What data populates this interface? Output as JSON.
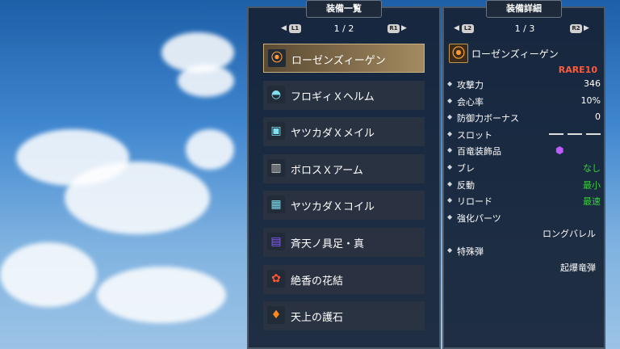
{
  "left_panel": {
    "title": "装備一覧",
    "pager": {
      "left_btn": "L1",
      "page": "1 / 2",
      "right_btn": "R1"
    },
    "items": [
      {
        "label": "ローゼンズィーゲン",
        "icon": "gun-icon",
        "glyph": "⦿",
        "color": "#ff9a33",
        "selected": true
      },
      {
        "label": "フロギィＸヘルム",
        "icon": "helmet-icon",
        "glyph": "◓",
        "color": "#7fe0f0"
      },
      {
        "label": "ヤツカダＸメイル",
        "icon": "chest-armor-icon",
        "glyph": "▣",
        "color": "#7fe0f0"
      },
      {
        "label": "ボロスＸアーム",
        "icon": "arm-armor-icon",
        "glyph": "▥",
        "color": "#d8d8d8"
      },
      {
        "label": "ヤツカダＸコイル",
        "icon": "waist-armor-icon",
        "glyph": "▦",
        "color": "#7fe0f0"
      },
      {
        "label": "斉天ノ具足・真",
        "icon": "leg-armor-icon",
        "glyph": "▤",
        "color": "#8a5cff"
      },
      {
        "label": "絶香の花結",
        "icon": "petalace-icon",
        "glyph": "✿",
        "color": "#ff5533"
      },
      {
        "label": "天上の護石",
        "icon": "talisman-icon",
        "glyph": "♦",
        "color": "#ff8a1a"
      }
    ]
  },
  "right_panel": {
    "title": "装備詳細",
    "pager": {
      "left_btn": "L2",
      "page": "1 / 3",
      "right_btn": "R2"
    },
    "weapon_name": "ローゼンズィーゲン",
    "weapon_icon": "gun-icon",
    "rarity": "RARE10",
    "stats": [
      {
        "label": "攻撃力",
        "value": "346"
      },
      {
        "label": "会心率",
        "value": "10%"
      },
      {
        "label": "防御力ボーナス",
        "value": "0"
      },
      {
        "label": "スロット",
        "value": "",
        "slots": true
      },
      {
        "label": "百竜装飾品",
        "value": "",
        "deco_icon": "rampage-deco-icon"
      },
      {
        "label": "ブレ",
        "value": "なし",
        "green": true
      },
      {
        "label": "反動",
        "value": "最小",
        "green": true
      },
      {
        "label": "リロード",
        "value": "最速",
        "green": true
      },
      {
        "label": "強化パーツ",
        "value": ""
      }
    ],
    "mod_value": "ロングバレル",
    "special_label": "特殊弾",
    "special_value": "起爆竜弾"
  },
  "colors": {
    "green": "#38d038",
    "rare": "#ff5a3a",
    "accent": "#c8b080"
  }
}
